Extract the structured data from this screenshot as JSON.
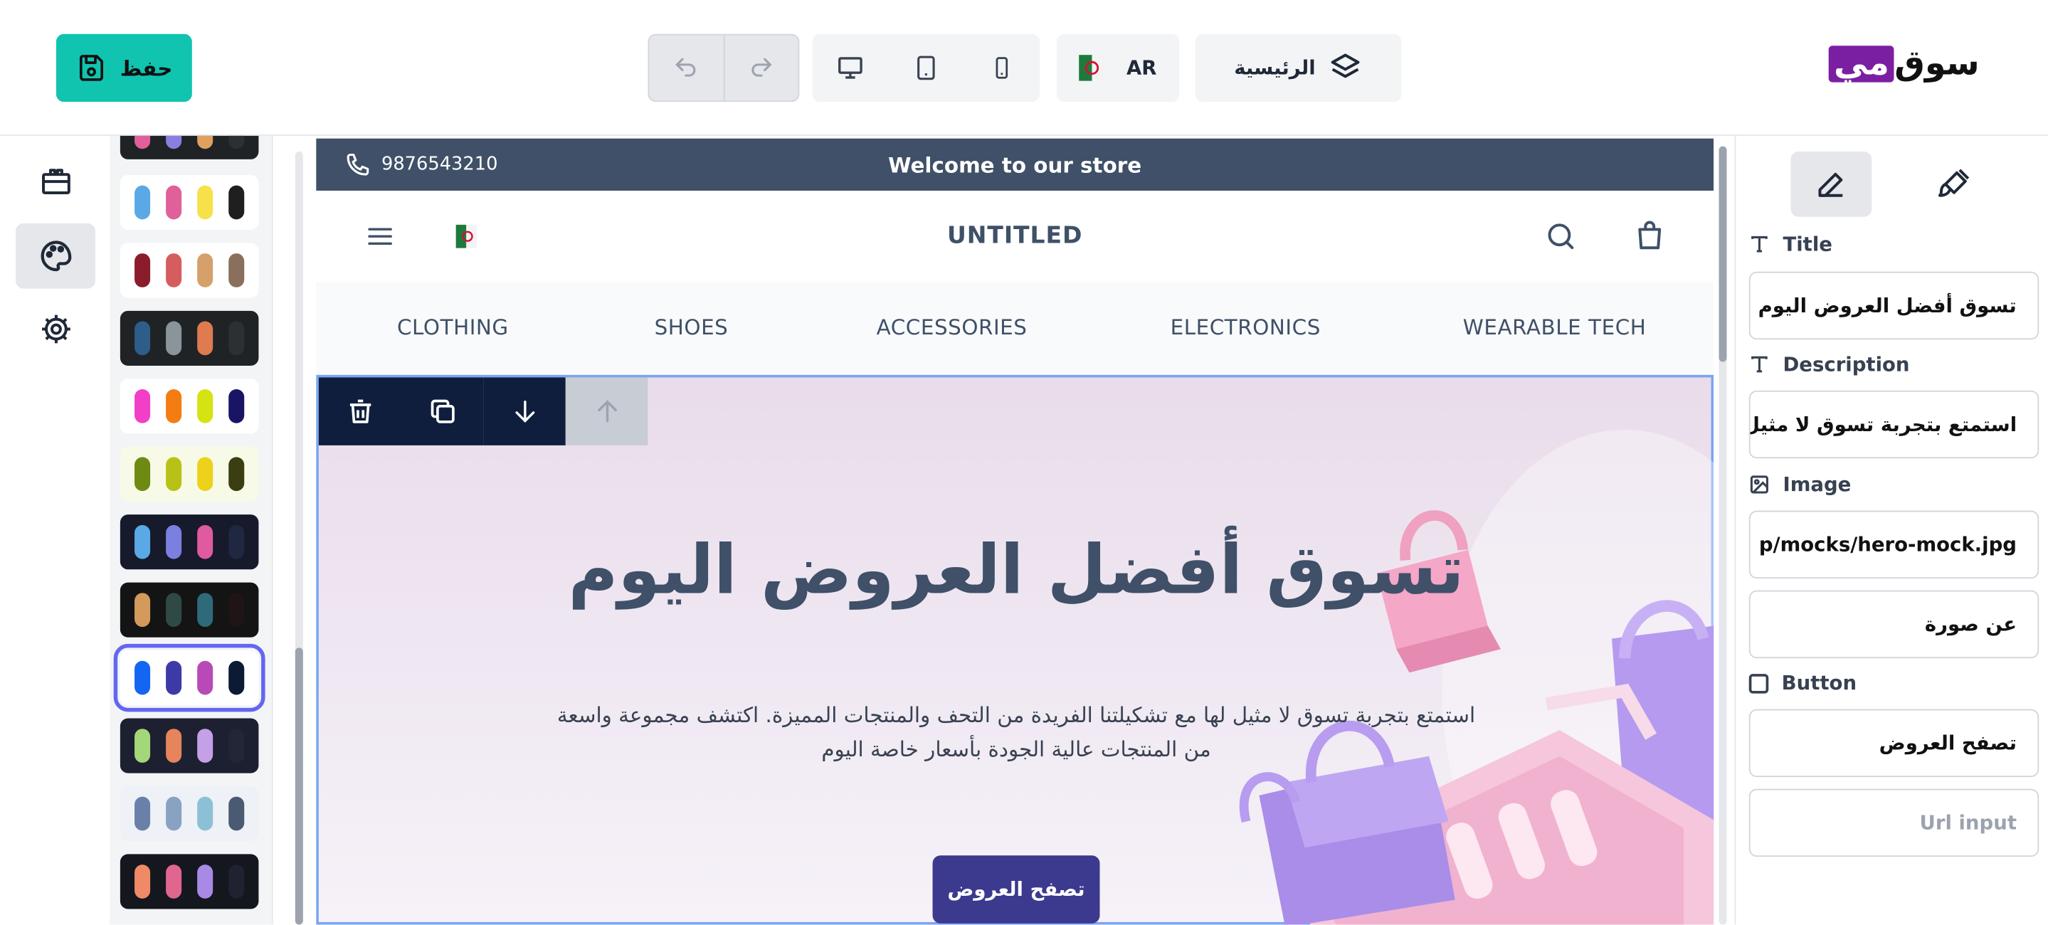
{
  "toolbar": {
    "save_label": "حفظ",
    "language_label": "AR",
    "page_label": "الرئيسية"
  },
  "brand": {
    "logo_part_a": "مي",
    "logo_part_b": "سوق"
  },
  "palettes": [
    {
      "bg": "#ffffff",
      "colors": [
        "#5aa9e6",
        "#e0609a",
        "#f6e14b",
        "#1f1f1f"
      ]
    },
    {
      "bg": "#ffffff",
      "colors": [
        "#8a1c2b",
        "#d65d5d",
        "#d6a06a",
        "#8a6f5c"
      ]
    },
    {
      "bg": "#1f2326",
      "colors": [
        "#2f5d8a",
        "#8a949b",
        "#e07a4f",
        "#2b3034"
      ]
    },
    {
      "bg": "#ffffff",
      "colors": [
        "#f23fc7",
        "#f57c12",
        "#d6e312",
        "#1a1466"
      ]
    },
    {
      "bg": "#f7fae6",
      "colors": [
        "#6e8a12",
        "#b8c216",
        "#ecd21a",
        "#3b3d12"
      ]
    },
    {
      "bg": "#161a2b",
      "colors": [
        "#5aa9e6",
        "#7b7fe0",
        "#e05aa0",
        "#1f2840"
      ]
    },
    {
      "bg": "#141414",
      "colors": [
        "#d49a5c",
        "#2f4a45",
        "#2f6a7a",
        "#1f1416"
      ]
    },
    {
      "bg": "#ffffff",
      "colors": [
        "#1466f2",
        "#3d3aa8",
        "#b84ab8",
        "#0d1a33"
      ]
    },
    {
      "bg": "#1d2030",
      "colors": [
        "#a4d67a",
        "#e6845c",
        "#c4a0e6",
        "#232636"
      ]
    },
    {
      "bg": "#eef1f6",
      "colors": [
        "#6a80a8",
        "#8aa2c2",
        "#8cc0d6",
        "#4a5a72"
      ]
    },
    {
      "bg": "#15171f",
      "colors": [
        "#f08a66",
        "#e06690",
        "#a88ae6",
        "#1f2230"
      ]
    }
  ],
  "store": {
    "phone": "9876543210",
    "welcome": "Welcome to our store",
    "name": "UNTITLED",
    "categories": [
      "CLOTHING",
      "SHOES",
      "ACCESSORIES",
      "ELECTRONICS",
      "WEARABLE TECH"
    ]
  },
  "hero": {
    "title": "تسوق أفضل العروض اليوم",
    "description": "استمتع بتجربة تسوق لا مثيل لها مع تشكيلتنا الفريدة من التحف والمنتجات المميزة. اكتشف مجموعة واسعة من المنتجات عالية الجودة بأسعار خاصة اليوم",
    "button": "تصفح العروض"
  },
  "settings": {
    "title_label": "Title",
    "title_value": "تسوق أفضل العروض اليوم",
    "description_label": "Description",
    "description_value": "استمتع بتجربة تسوق لا مثيل ل",
    "image_label": "Image",
    "image_value": "p/mocks/hero-mock.jpg",
    "image_alt_value": "عن صورة",
    "button_label": "Button",
    "button_text_value": "تصفح العروض",
    "url_placeholder": "Url input"
  }
}
